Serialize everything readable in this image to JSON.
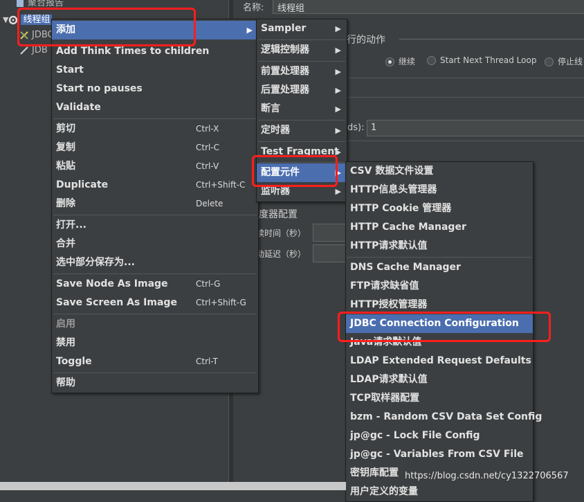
{
  "tree": {
    "items": [
      {
        "label": "聚合报告"
      },
      {
        "label": "线程组"
      },
      {
        "label": "JDBC"
      },
      {
        "label": "JDB"
      }
    ]
  },
  "panel": {
    "name_label": "名称:",
    "name_value": "线程组",
    "error_action_label": "行的动作",
    "radio_continue": "继续",
    "radio_next_loop": "Start Next Thread Loop",
    "radio_stop": "停止线",
    "loop_label": "ds):",
    "loop_value": "1",
    "scheduler_label": "度器配置",
    "duration_label": "续时间（秒）",
    "delay_label": "动延迟（秒）"
  },
  "context_menu": {
    "items": [
      {
        "label": "添加",
        "submenu": true
      },
      {
        "label": "Add Think Times to children"
      },
      {
        "label": "Start"
      },
      {
        "label": "Start no pauses"
      },
      {
        "label": "Validate"
      },
      {
        "label": "剪切",
        "shortcut": "Ctrl-X"
      },
      {
        "label": "复制",
        "shortcut": "Ctrl-C"
      },
      {
        "label": "粘贴",
        "shortcut": "Ctrl-V"
      },
      {
        "label": "Duplicate",
        "shortcut": "Ctrl+Shift-C"
      },
      {
        "label": "删除",
        "shortcut": "Delete"
      },
      {
        "label": "打开..."
      },
      {
        "label": "合并"
      },
      {
        "label": "选中部分保存为..."
      },
      {
        "label": "Save Node As Image",
        "shortcut": "Ctrl-G"
      },
      {
        "label": "Save Screen As Image",
        "shortcut": "Ctrl+Shift-G"
      },
      {
        "label": "启用"
      },
      {
        "label": "禁用"
      },
      {
        "label": "Toggle",
        "shortcut": "Ctrl-T"
      },
      {
        "label": "帮助"
      }
    ]
  },
  "add_submenu": {
    "items": [
      {
        "label": "Sampler"
      },
      {
        "label": "逻辑控制器"
      },
      {
        "label": "前置处理器"
      },
      {
        "label": "后置处理器"
      },
      {
        "label": "断言"
      },
      {
        "label": "定时器"
      },
      {
        "label": "Test Fragment"
      },
      {
        "label": "配置元件"
      },
      {
        "label": "监听器"
      }
    ]
  },
  "config_submenu": {
    "items": [
      {
        "label": "CSV 数据文件设置"
      },
      {
        "label": "HTTP信息头管理器"
      },
      {
        "label": "HTTP Cookie 管理器"
      },
      {
        "label": "HTTP Cache Manager"
      },
      {
        "label": "HTTP请求默认值"
      },
      {
        "label": "DNS Cache Manager"
      },
      {
        "label": "FTP请求缺省值"
      },
      {
        "label": "HTTP授权管理器"
      },
      {
        "label": "JDBC Connection Configuration"
      },
      {
        "label": "Java请求默认值"
      },
      {
        "label": "LDAP Extended Request Defaults"
      },
      {
        "label": "LDAP请求默认值"
      },
      {
        "label": "TCP取样器配置"
      },
      {
        "label": "bzm - Random CSV Data Set Config"
      },
      {
        "label": "jp@gc - Lock File Config"
      },
      {
        "label": "jp@gc - Variables From CSV File"
      },
      {
        "label": "密钥库配置"
      },
      {
        "label": "用户定义的变量"
      }
    ]
  },
  "watermark": "https://blog.csdn.net/cy1322706567",
  "colors": {
    "highlight": "#4b6eaf",
    "annotation": "#ff1e1e",
    "background": "#3c3f41"
  }
}
